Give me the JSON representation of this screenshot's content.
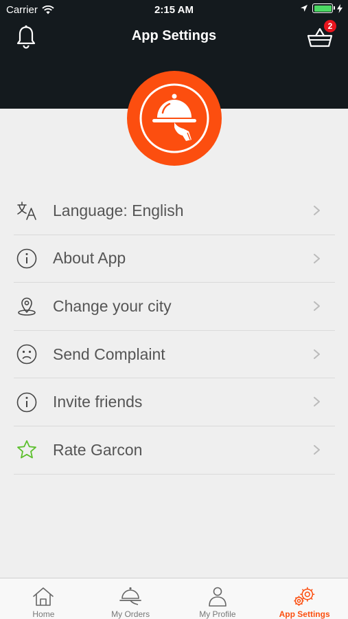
{
  "status_bar": {
    "carrier": "Carrier",
    "time": "2:15 AM"
  },
  "header": {
    "title": "App Settings",
    "cart_count": "2"
  },
  "menu": [
    {
      "label": "Language: English",
      "icon": "translate-icon"
    },
    {
      "label": "About App",
      "icon": "info-icon"
    },
    {
      "label": "Change your city",
      "icon": "location-pin-icon"
    },
    {
      "label": "Send Complaint",
      "icon": "sad-face-icon"
    },
    {
      "label": "Invite friends",
      "icon": "info-icon"
    },
    {
      "label": "Rate Garcon",
      "icon": "star-icon"
    }
  ],
  "tabbar": [
    {
      "label": "Home",
      "icon": "home-icon"
    },
    {
      "label": "My Orders",
      "icon": "cloche-icon"
    },
    {
      "label": "My Profile",
      "icon": "person-icon"
    },
    {
      "label": "App Settings",
      "icon": "gears-icon",
      "active": true
    }
  ],
  "colors": {
    "header_bg": "#141a1e",
    "accent": "#fc4e0f",
    "star_green": "#5bbf2c",
    "badge_red": "#e8141d"
  }
}
